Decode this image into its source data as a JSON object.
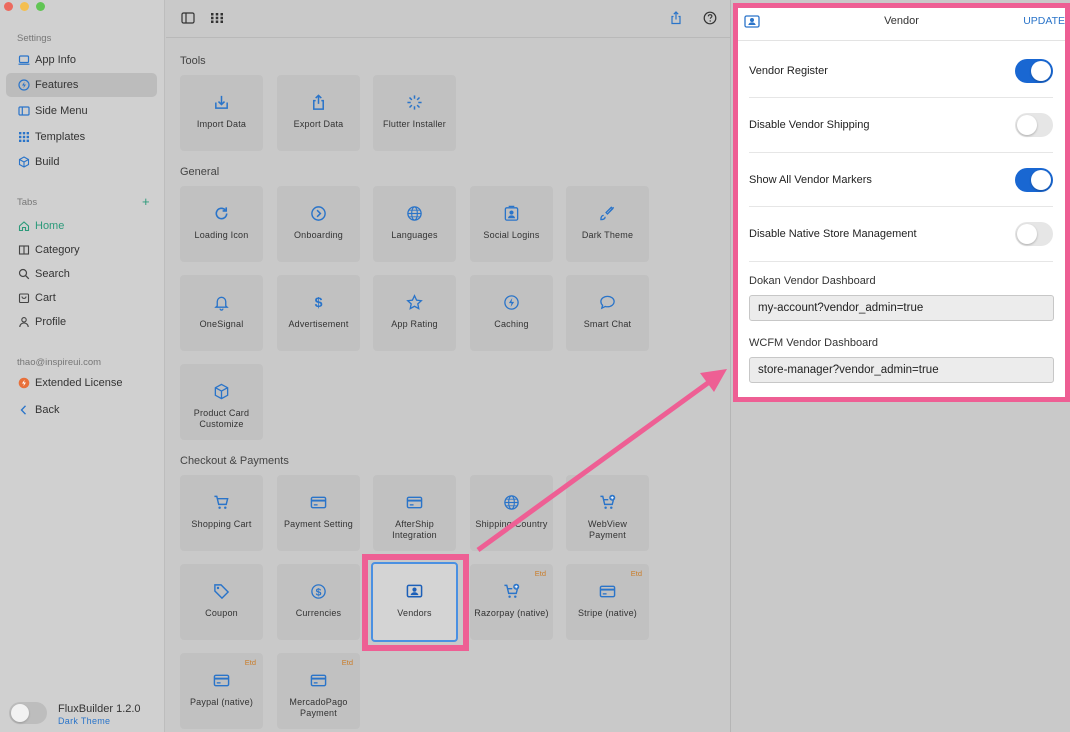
{
  "sidebar": {
    "settings_header": "Settings",
    "settings_items": [
      {
        "label": "App Info"
      },
      {
        "label": "Features"
      },
      {
        "label": "Side Menu"
      },
      {
        "label": "Templates"
      },
      {
        "label": "Build"
      }
    ],
    "tabs_header": "Tabs",
    "tabs_add": "+",
    "tab_items": [
      {
        "label": "Home"
      },
      {
        "label": "Category"
      },
      {
        "label": "Search"
      },
      {
        "label": "Cart"
      },
      {
        "label": "Profile"
      }
    ],
    "account_email": "thao@inspireui.com",
    "extended_license": "Extended License",
    "back": "Back",
    "footer_title": "FluxBuilder 1.2.0",
    "footer_subtitle": "Dark Theme"
  },
  "groups": {
    "tools": "Tools",
    "general": "General",
    "checkout": "Checkout & Payments"
  },
  "tools_tiles": [
    {
      "label": "Import Data",
      "icon": "download-icon"
    },
    {
      "label": "Export Data",
      "icon": "share-icon"
    },
    {
      "label": "Flutter Installer",
      "icon": "spinner-icon"
    }
  ],
  "general_tiles": [
    {
      "label": "Loading Icon",
      "icon": "refresh-icon"
    },
    {
      "label": "Onboarding",
      "icon": "chevron-circle-icon"
    },
    {
      "label": "Languages",
      "icon": "globe-icon"
    },
    {
      "label": "Social Logins",
      "icon": "contact-card-icon"
    },
    {
      "label": "Dark Theme",
      "icon": "paint-brush-icon"
    },
    {
      "label": "OneSignal",
      "icon": "bell-icon"
    },
    {
      "label": "Advertisement",
      "icon": "dollar-icon"
    },
    {
      "label": "App Rating",
      "icon": "star-icon"
    },
    {
      "label": "Caching",
      "icon": "bolt-icon"
    },
    {
      "label": "Smart Chat",
      "icon": "chat-icon"
    },
    {
      "label": "Product Card Customize",
      "icon": "cube-icon"
    }
  ],
  "checkout_tiles": [
    {
      "label": "Shopping Cart",
      "icon": "cart-icon",
      "badge": ""
    },
    {
      "label": "Payment Setting",
      "icon": "card-icon",
      "badge": ""
    },
    {
      "label": "AfterShip Integration",
      "icon": "card-icon",
      "badge": ""
    },
    {
      "label": "Shipping Country",
      "icon": "globe-icon",
      "badge": ""
    },
    {
      "label": "WebView Payment",
      "icon": "cart-plus-icon",
      "badge": ""
    },
    {
      "label": "Coupon",
      "icon": "tag-icon",
      "badge": ""
    },
    {
      "label": "Currencies",
      "icon": "dollar-circle-icon",
      "badge": ""
    },
    {
      "label": "Vendors",
      "icon": "vendor-icon",
      "badge": ""
    },
    {
      "label": "Razorpay (native)",
      "icon": "cart-plus-icon",
      "badge": "Etd"
    },
    {
      "label": "Stripe (native)",
      "icon": "card-icon",
      "badge": "Etd"
    },
    {
      "label": "Paypal (native)",
      "icon": "card-icon",
      "badge": "Etd"
    },
    {
      "label": "MercadoPago Payment",
      "icon": "card-icon",
      "badge": "Etd"
    }
  ],
  "vendor_panel": {
    "title": "Vendor",
    "update": "UPDATE",
    "toggles": [
      {
        "label": "Vendor Register",
        "on": true
      },
      {
        "label": "Disable Vendor Shipping",
        "on": false
      },
      {
        "label": "Show All Vendor Markers",
        "on": true
      },
      {
        "label": "Disable Native Store Management",
        "on": false
      }
    ],
    "dokan_label": "Dokan Vendor Dashboard",
    "dokan_value": "my-account?vendor_admin=true",
    "wcfm_label": "WCFM Vendor Dashboard",
    "wcfm_value": "store-manager?vendor_admin=true"
  },
  "colors": {
    "accent": "#1967d2",
    "highlight": "#ee5f94",
    "badge": "#c97d2a",
    "tab_active": "#2c9a7a"
  }
}
